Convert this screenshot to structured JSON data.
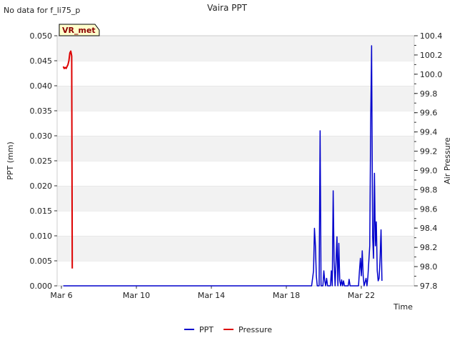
{
  "header": {
    "note": "No data for f_li75_p"
  },
  "chart_data": {
    "type": "line",
    "title": "Vaira PPT",
    "xlabel": "Time",
    "ylabel_left": "PPT (mm)",
    "ylabel_right": "Air Pressure",
    "x_start": "Mar 6",
    "xlim_days": [
      0,
      18
    ],
    "x_ticks": [
      {
        "day": 0,
        "label": "Mar 6"
      },
      {
        "day": 4,
        "label": "Mar 10"
      },
      {
        "day": 8,
        "label": "Mar 14"
      },
      {
        "day": 12,
        "label": "Mar 18"
      },
      {
        "day": 16,
        "label": "Mar 22"
      }
    ],
    "ylim_left": [
      0,
      0.05
    ],
    "yticks_left": [
      "0.000",
      "0.005",
      "0.010",
      "0.015",
      "0.020",
      "0.025",
      "0.030",
      "0.035",
      "0.040",
      "0.045",
      "0.050"
    ],
    "ylim_right": [
      97.8,
      100.4
    ],
    "yticks_right": [
      "97.8",
      "98.0",
      "98.2",
      "98.4",
      "98.6",
      "98.8",
      "99.0",
      "99.2",
      "99.4",
      "99.6",
      "99.8",
      "100.0",
      "100.2",
      "100.4"
    ],
    "grid": "horizontal bands",
    "legend": "bottom-center",
    "annotation": "VR_met",
    "series": [
      {
        "name": "PPT",
        "color": "#0000cc",
        "axis": "left",
        "points": [
          [
            0.1,
            0
          ],
          [
            13.35,
            0
          ],
          [
            13.45,
            0.003
          ],
          [
            13.5,
            0.0115
          ],
          [
            13.55,
            0.008
          ],
          [
            13.6,
            0.002
          ],
          [
            13.65,
            0
          ],
          [
            13.75,
            0
          ],
          [
            13.8,
            0.031
          ],
          [
            13.85,
            0
          ],
          [
            13.95,
            0
          ],
          [
            14.0,
            0.003
          ],
          [
            14.05,
            0.001
          ],
          [
            14.1,
            0
          ],
          [
            14.15,
            0.0015
          ],
          [
            14.2,
            0
          ],
          [
            14.35,
            0
          ],
          [
            14.4,
            0.003
          ],
          [
            14.45,
            0
          ],
          [
            14.5,
            0.019
          ],
          [
            14.55,
            0.005
          ],
          [
            14.6,
            0
          ],
          [
            14.7,
            0.0098
          ],
          [
            14.75,
            0
          ],
          [
            14.8,
            0.0085
          ],
          [
            14.85,
            0.001
          ],
          [
            14.9,
            0
          ],
          [
            14.95,
            0.0012
          ],
          [
            15.0,
            0
          ],
          [
            15.05,
            0.001
          ],
          [
            15.1,
            0
          ],
          [
            15.3,
            0
          ],
          [
            15.35,
            0.0013
          ],
          [
            15.4,
            0
          ],
          [
            15.85,
            0
          ],
          [
            15.9,
            0.003
          ],
          [
            15.95,
            0.0055
          ],
          [
            16.0,
            0.002
          ],
          [
            16.05,
            0.007
          ],
          [
            16.1,
            0.002
          ],
          [
            16.15,
            0
          ],
          [
            16.25,
            0.0015
          ],
          [
            16.3,
            0
          ],
          [
            16.35,
            0.0018
          ],
          [
            16.45,
            0.008
          ],
          [
            16.5,
            0.0325
          ],
          [
            16.55,
            0.048
          ],
          [
            16.6,
            0.01
          ],
          [
            16.65,
            0.0055
          ],
          [
            16.7,
            0.0225
          ],
          [
            16.75,
            0.008
          ],
          [
            16.8,
            0.0128
          ],
          [
            16.85,
            0.003
          ],
          [
            16.9,
            0.001
          ],
          [
            16.95,
            0.0015
          ],
          [
            17.0,
            0.0055
          ],
          [
            17.05,
            0.0112
          ],
          [
            17.1,
            0.001
          ]
        ]
      },
      {
        "name": "Pressure",
        "color": "#dd0000",
        "axis": "right",
        "points": [
          [
            0.1,
            100.08
          ],
          [
            0.15,
            100.06
          ],
          [
            0.2,
            100.07
          ],
          [
            0.25,
            100.06
          ],
          [
            0.3,
            100.08
          ],
          [
            0.35,
            100.1
          ],
          [
            0.4,
            100.14
          ],
          [
            0.45,
            100.22
          ],
          [
            0.5,
            100.24
          ],
          [
            0.55,
            100.19
          ],
          [
            0.58,
            97.98
          ]
        ]
      }
    ]
  }
}
